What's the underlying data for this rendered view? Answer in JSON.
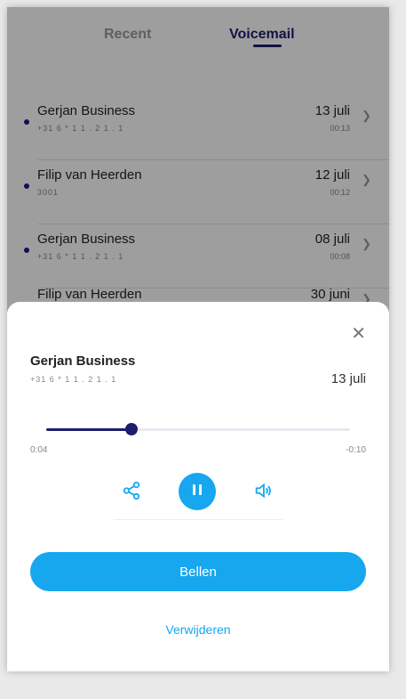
{
  "tabs": {
    "recent": "Recent",
    "voicemail": "Voicemail"
  },
  "voicemails": [
    {
      "name": "Gerjan Business",
      "number": "+31 6 * 1 1 . 2 1 . 1",
      "date": "13 juli",
      "duration": "00:13",
      "unread": true
    },
    {
      "name": "Filip van Heerden",
      "number": "3001",
      "date": "12 juli",
      "duration": "00:12",
      "unread": true
    },
    {
      "name": "Gerjan Business",
      "number": "+31 6 * 1 1 . 2 1 . 1",
      "date": "08 juli",
      "duration": "00:08",
      "unread": true
    },
    {
      "name": "Filip van Heerden",
      "number": "",
      "date": "30 juni",
      "duration": "",
      "unread": false
    }
  ],
  "sheet": {
    "close_icon": "close-icon",
    "caller_name": "Gerjan Business",
    "caller_number": "+31 6 * 1 1 . 2 1 . 1",
    "date": "13 juli",
    "progress": 0.28,
    "elapsed": "0:04",
    "remaining": "-0:10",
    "call_label": "Bellen",
    "delete_label": "Verwijderen"
  },
  "colors": {
    "accent": "#16a7ef",
    "navy": "#1d1d6e"
  }
}
